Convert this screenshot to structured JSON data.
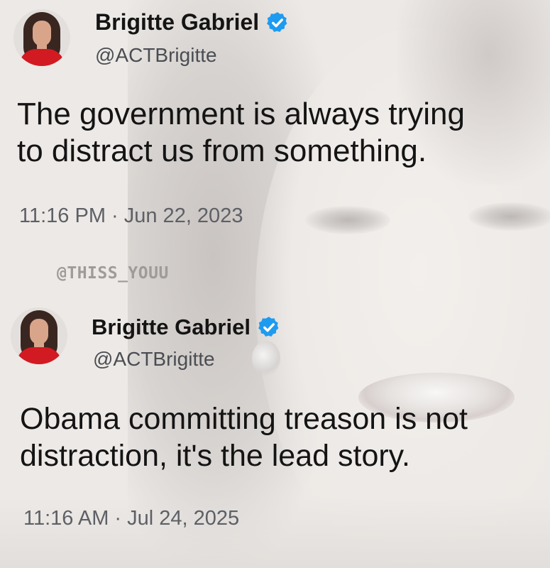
{
  "watermark": "@THISS_YOUU",
  "tweets": [
    {
      "author_name": "Brigitte Gabriel",
      "handle": "@ACTBrigitte",
      "text_lines": [
        "The government is always trying",
        "to distract us from something."
      ],
      "timestamp": "11:16 PM · Jun 22, 2023",
      "verified_icon": "verified-badge-icon"
    },
    {
      "author_name": "Brigitte Gabriel",
      "handle": "@ACTBrigitte",
      "text_lines": [
        "Obama committing treason is not",
        "distraction, it's the lead story."
      ],
      "timestamp": "11:16 AM · Jul 24, 2025",
      "verified_icon": "verified-badge-icon"
    }
  ],
  "colors": {
    "verified_blue": "#1d9bf0",
    "text_primary": "#141414",
    "text_secondary": "#5d6066",
    "background": "#ede9e6"
  }
}
